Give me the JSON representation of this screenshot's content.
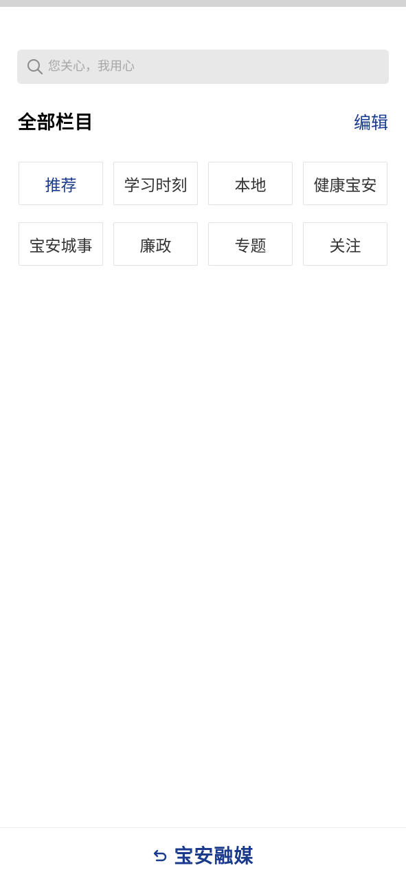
{
  "search": {
    "placeholder": "您关心，我用心"
  },
  "section": {
    "title": "全部栏目",
    "edit_label": "编辑"
  },
  "channels": [
    {
      "label": "推荐",
      "active": true
    },
    {
      "label": "学习时刻",
      "active": false
    },
    {
      "label": "本地",
      "active": false
    },
    {
      "label": "健康宝安",
      "active": false
    },
    {
      "label": "宝安城事",
      "active": false
    },
    {
      "label": "廉政",
      "active": false
    },
    {
      "label": "专题",
      "active": false
    },
    {
      "label": "关注",
      "active": false
    }
  ],
  "footer": {
    "icon": "return-arrow-icon",
    "brand": "宝安融媒"
  },
  "colors": {
    "accent": "#1a3a8c",
    "search_bg": "#e8e8e8",
    "placeholder": "#a6a6a6",
    "item_border": "#e2e2e2",
    "item_text": "#333333",
    "top_strip": "#d4d4d4"
  }
}
